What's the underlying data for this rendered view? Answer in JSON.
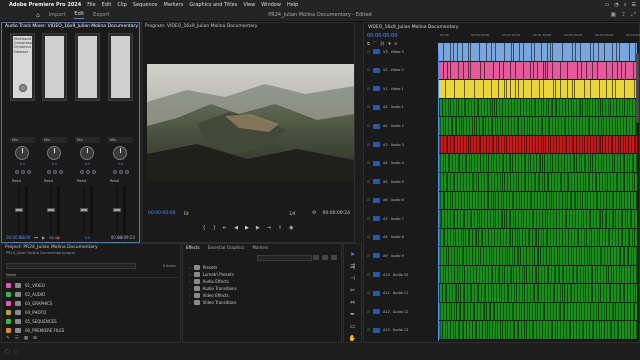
{
  "menubar": {
    "app_name": "Adobe Premiere Pro 2024",
    "items": [
      "File",
      "Edit",
      "Clip",
      "Sequence",
      "Markers",
      "Graphics and Titles",
      "View",
      "Window",
      "Help"
    ]
  },
  "workspace": {
    "tabs": [
      "Import",
      "Edit",
      "Export"
    ],
    "active_tab": "Edit",
    "project_title": "PR24_Julian Molina Documentary - Edited"
  },
  "mixer": {
    "title": "Audio Track Mixer: VIDEO_16x9_Julian Molina Documentary",
    "effect_text": [
      "Multiband Compressor",
      "Dynamics",
      "Deesser"
    ],
    "channels": [
      {
        "dd": "Mix",
        "pan": "0.0",
        "read": "Read",
        "fader": "0.0",
        "label": "A1",
        "name": "Audio 1"
      },
      {
        "dd": "Mix",
        "pan": "0.0",
        "read": "Read",
        "fader": "0.0",
        "label": "A2",
        "name": "Audio 2"
      },
      {
        "dd": "Mix",
        "pan": "0.0",
        "read": "Read",
        "fader": "0.0",
        "label": "A3",
        "name": "Audio 3"
      },
      {
        "dd": "Mix",
        "pan": "0.0",
        "read": "Read",
        "fader": "0.0",
        "label": "A4",
        "name": "Audio 4"
      }
    ],
    "timecode": "00:00:00:00",
    "duration": "00:00:09:24"
  },
  "program": {
    "title": "Program: VIDEO_16x9_Julian Molina Documentary",
    "timecode": "00:00:00:00",
    "fit": "Fit",
    "resolution": "1/4",
    "duration": "00:00:09:24"
  },
  "timeline": {
    "title": "VIDEO_16x9_Julian Molina Documentary",
    "timecode": "00:00:00:00",
    "ruler": [
      "00:00",
      "00:00:30:00",
      "00:01:00:00",
      "00:01:30:00",
      "00:02:00:00",
      "00:02:30:00",
      "00:03:00:00"
    ],
    "tracks": [
      {
        "id": "V3",
        "name": "Video 3",
        "kind": "v3"
      },
      {
        "id": "V2",
        "name": "Video 2",
        "kind": "v2"
      },
      {
        "id": "V1",
        "name": "Video 1",
        "kind": "v1"
      },
      {
        "id": "A1",
        "name": "Audio 1",
        "kind": "a"
      },
      {
        "id": "A2",
        "name": "Audio 2",
        "kind": "a"
      },
      {
        "id": "A3",
        "name": "Audio 3",
        "kind": "a-r"
      },
      {
        "id": "A4",
        "name": "Audio 4",
        "kind": "a"
      },
      {
        "id": "A5",
        "name": "Audio 5",
        "kind": "a"
      },
      {
        "id": "A6",
        "name": "Audio 6",
        "kind": "a"
      },
      {
        "id": "A7",
        "name": "Audio 7",
        "kind": "a"
      },
      {
        "id": "A8",
        "name": "Audio 8",
        "kind": "a"
      },
      {
        "id": "A9",
        "name": "Audio 9",
        "kind": "a"
      },
      {
        "id": "A10",
        "name": "Audio 10",
        "kind": "a"
      },
      {
        "id": "A11",
        "name": "Audio 11",
        "kind": "a"
      },
      {
        "id": "A12",
        "name": "Audio 12",
        "kind": "a"
      },
      {
        "id": "A13",
        "name": "Audio 13",
        "kind": "a"
      }
    ]
  },
  "project": {
    "title": "Project: PR24_Julian Molina Documentary",
    "path": "PR24_Julian Molina Documentary.prproj",
    "items_count": "6 Items",
    "column_name": "Name",
    "bins": [
      {
        "name": "01_VIDEO",
        "color": "#e05ab0"
      },
      {
        "name": "02_AUDIO",
        "color": "#3cb84a"
      },
      {
        "name": "03_GRAPHICS",
        "color": "#e05ab0"
      },
      {
        "name": "04_PHOTO",
        "color": "#b5a13c"
      },
      {
        "name": "05_SEQUENCES",
        "color": "#3cb84a"
      },
      {
        "name": "06_PREMIERE FILES",
        "color": "#d98a2d"
      }
    ]
  },
  "effects": {
    "tabs": [
      "Effects",
      "Essential Graphics",
      "Markers"
    ],
    "folders": [
      "Presets",
      "Lumetri Presets",
      "Audio Effects",
      "Audio Transitions",
      "Video Effects",
      "Video Transitions"
    ]
  }
}
